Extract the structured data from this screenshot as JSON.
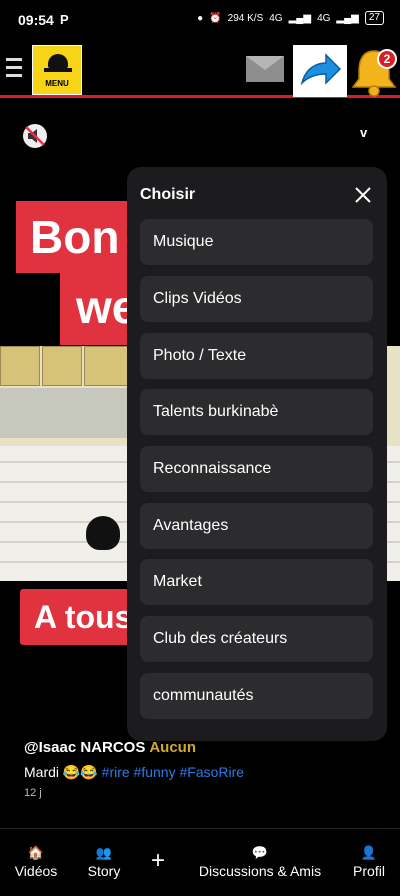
{
  "status_bar": {
    "time": "09:54",
    "carrier_icon": "P",
    "data_rate": "294 K/S",
    "network_1": "4G",
    "network_2": "4G",
    "battery": "27"
  },
  "header": {
    "menu_logo_text": "MENU",
    "notification_count": "2"
  },
  "video": {
    "mute_state": "muted",
    "toggle_label": "v",
    "overlay_text_top_1": "Bon",
    "overlay_text_top_2": "we",
    "overlay_text_bottom": "A tous",
    "author": "@Isaac NARCOS",
    "subscription": "Aucun",
    "description_text": "Mardi 😂😂",
    "hashtags": "#rire #funny #FasoRire",
    "age": "12 j"
  },
  "menu": {
    "title": "Choisir",
    "items": [
      "Musique",
      "Clips Vidéos",
      "Photo / Texte",
      "Talents burkinabè",
      "Reconnaissance",
      "Avantages",
      "Market",
      "Club des créateurs",
      "communautés"
    ]
  },
  "bottom_nav": {
    "videos": "Vidéos",
    "story": "Story",
    "add": "+",
    "discussions": "Discussions & Amis",
    "profil": "Profil"
  },
  "colors": {
    "accent_red": "#d81f26",
    "menu_bg": "#1c1c1e",
    "menu_item_bg": "#2c2c2e",
    "hashtag": "#2c7be5",
    "subscription": "#d3a927"
  }
}
